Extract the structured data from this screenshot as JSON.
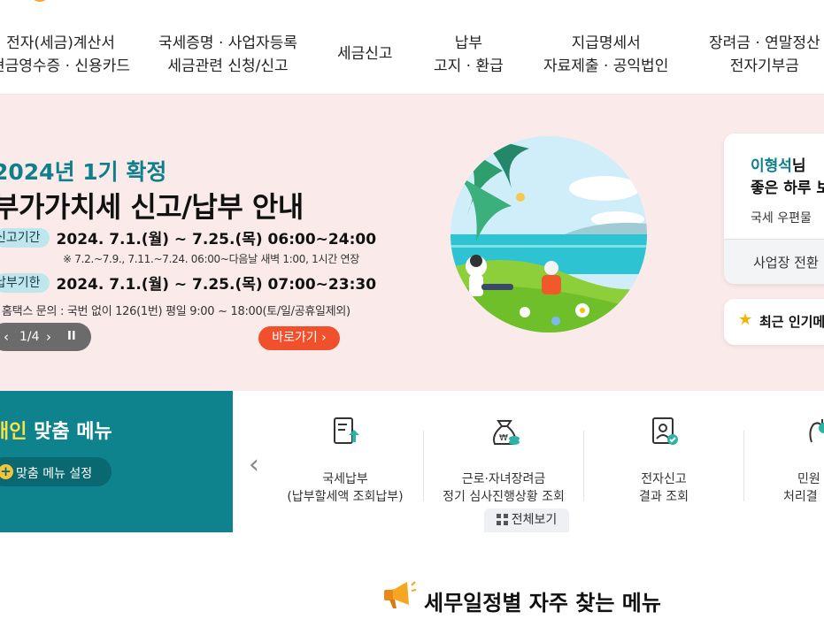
{
  "nav": {
    "items": [
      {
        "line1": "전자(세금)계산서",
        "line2": "현금영수증 · 신용카드"
      },
      {
        "line1": "국세증명 · 사업자등록",
        "line2": "세금관련 신청/신고"
      },
      {
        "line1": "세금신고",
        "line2": ""
      },
      {
        "line1": "납부",
        "line2": "고지 · 환급"
      },
      {
        "line1": "지급명세서",
        "line2": "자료제출 · 공익법인"
      },
      {
        "line1": "장려금 · 연말정산",
        "line2": "전자기부금"
      }
    ]
  },
  "banner": {
    "title_line1": "2024년 1기 확정",
    "title_line2": "부가가치세 신고/납부 안내",
    "filing_label": "신고기간",
    "filing_text": "2024. 7.1.(월) ~ 7.25.(목) 06:00~24:00",
    "filing_note": "※ 7.2.~7.9., 7.11.~7.24. 06:00~다음날 새벽 1:00, 1시간 연장",
    "payment_label": "납부기한",
    "payment_text": "2024. 7.1.(월) ~ 7.25.(목) 07:00~23:30",
    "inquiry_text": "홈택스 문의 : 국번 없이 126(1번) 평일 9:00 ~ 18:00(토/일/공휴일제외)",
    "pager_text": "1/4",
    "go_label": "바로가기 ›",
    "colors": {
      "bg": "#faeaea",
      "accent_teal": "#0f7f8c",
      "button_orange": "#f0502b"
    }
  },
  "user_card": {
    "name": "이형석",
    "suffix": "님",
    "greeting": "좋은 하루 보",
    "mail_label": "국세 우편물",
    "switch_label": "사업장 전환",
    "popular_label": "최근 인기메"
  },
  "custom_menu": {
    "title_highlight": "개인",
    "title_rest": " 맞춤 메뉴",
    "settings_label": "맞춤 메뉴 설정",
    "items": [
      {
        "line1": "국세납부",
        "line2": "(납부할세액 조회납부)",
        "icon": "document-upload-icon"
      },
      {
        "line1": "근로·자녀장려금",
        "line2": "정기 심사진행상황 조회",
        "icon": "money-bag-icon"
      },
      {
        "line1": "전자신고",
        "line2": "결과 조회",
        "icon": "document-check-icon"
      },
      {
        "line1": "민원",
        "line2": "처리결",
        "icon": "hand-icon"
      }
    ],
    "view_all_label": "전체보기"
  },
  "section": {
    "heading": "세무일정별 자주 찾는 메뉴",
    "icon": "megaphone-icon"
  }
}
